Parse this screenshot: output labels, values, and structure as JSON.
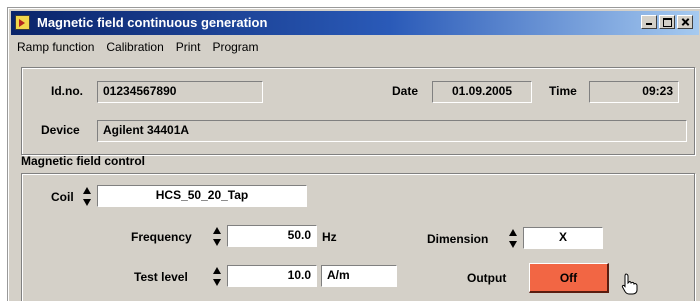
{
  "window": {
    "title": "Magnetic field continuous generation"
  },
  "menu": [
    "Ramp function",
    "Calibration",
    "Print",
    "Program"
  ],
  "info": {
    "id_label": "Id.no.",
    "id_value": "01234567890",
    "date_label": "Date",
    "date_value": "01.09.2005",
    "time_label": "Time",
    "time_value": "09:23",
    "device_label": "Device",
    "device_value": "Agilent 34401A"
  },
  "control": {
    "section_title": "Magnetic field control",
    "coil_label": "Coil",
    "coil_value": "HCS_50_20_Tap",
    "frequency_label": "Frequency",
    "frequency_value": "50.0",
    "frequency_unit": "Hz",
    "dimension_label": "Dimension",
    "dimension_value": "X",
    "test_level_label": "Test level",
    "test_level_value": "10.0",
    "test_level_unit": "A/m",
    "output_label": "Output",
    "output_button": "Off"
  },
  "colors": {
    "titlebar_start": "#0a246a",
    "output_off": "#f26644",
    "window_bg": "#d4d0c8"
  }
}
